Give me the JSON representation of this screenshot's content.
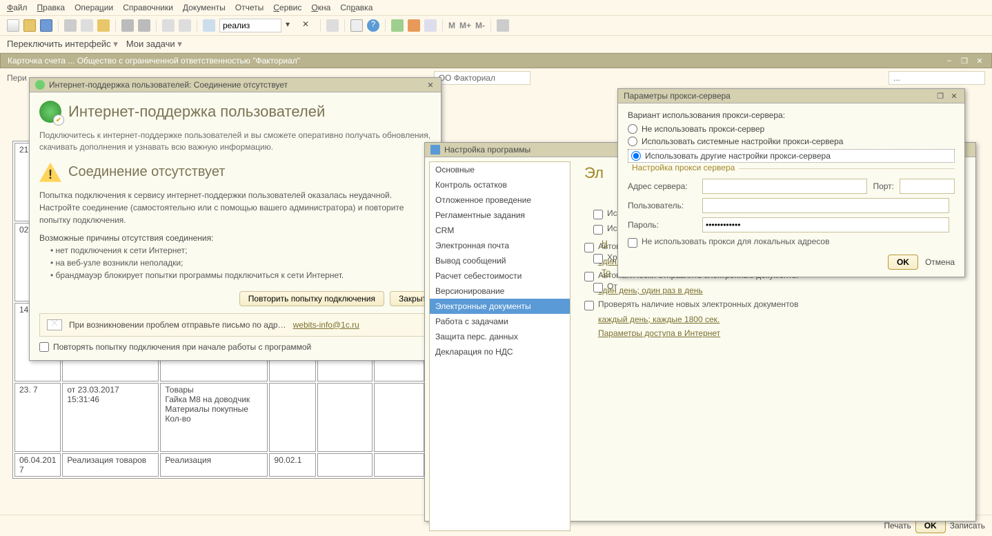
{
  "menubar": {
    "items": [
      "Файл",
      "Правка",
      "Операции",
      "Справочники",
      "Документы",
      "Отчеты",
      "Сервис",
      "Окна",
      "Справка"
    ]
  },
  "toolbar": {
    "search_value": "реализ",
    "m1": "M",
    "m2": "M+",
    "m3": "M-"
  },
  "switcher": {
    "a": "Переключить интерфейс",
    "b": "Мои задачи"
  },
  "doc_title": "Карточка счета ... Общество с ограниченной ответственностью \"Факториал\"",
  "bg": {
    "period_label": "Пери",
    "org_value": "ОО Факториал",
    "tbl": {
      "r1c1": "21.\n7",
      "r1c2": "",
      "r1c3": "",
      "r1c4": "",
      "r1c5": "",
      "r1c6": "",
      "r2c1": "02.\n7",
      "r2c2": "",
      "r2c3": "",
      "r2c4": "",
      "r2c5": "",
      "r2c6": "",
      "r3c1": "14.\n7",
      "r3c2": "",
      "r3c3": "",
      "r3c4": "",
      "r3c5": "",
      "r3c6": "",
      "r4c1": "23.\n7",
      "r4c2": "от 23.03.2017\n15:31:46",
      "r4c3": "Товары\nГайка М8 на доводчик\nМатериалы покупные\nКол-во",
      "r4c4": "",
      "r4c5": "",
      "r4c6": "",
      "r5c1": "06.04.201\n7",
      "r5c2": "Реализация товаров",
      "r5c3": "Реализация",
      "r5c4": "90.02.1",
      "r5c5": "",
      "r5c6": ""
    }
  },
  "bottom": {
    "a": "Печать",
    "b": "OK",
    "c": "Записать"
  },
  "isup": {
    "title": "Интернет-поддержка пользователей: Соединение отсутствует",
    "header": "Интернет-поддержка пользователей",
    "intro": "Подключитесь к интернет-поддержке пользователей и вы сможете оперативно получать обновления, скачивать дополнения и узнавать всю важную информацию.",
    "warn_title": "Соединение отсутствует",
    "text1": "Попытка подключения к сервису интернет-поддержки пользователей оказалась неудачной. Настройте соединение (самостоятельно или с помощью вашего администратора) и повторите попытку подключения.",
    "reasons_title": "Возможные причины отсутствия соединения:",
    "r1": "нет подключения к сети Интернет;",
    "r2": "на веб-узле возникли неполадки;",
    "r3": "брандмауэр блокирует попытки программы подключиться к сети Интернет.",
    "retry_btn": "Повторить попытку подключения",
    "close_btn": "Закрыть",
    "mail_text": "При возникновении проблем отправьте письмо по адр…",
    "mail_link": "webits-info@1c.ru",
    "chk_label": "Повторять попытку подключения при начале работы с программой"
  },
  "settings": {
    "title": "Настройка программы",
    "nav": [
      "Основные",
      "Контроль остатков",
      "Отложенное проведение",
      "Регламентные задания",
      "CRM",
      "Электронная почта",
      "Вывод сообщений",
      "Расчет себестоимости",
      "Версионирование",
      "Электронные документы",
      "Работа с задачами",
      "Защита перс. данных",
      "Декларация по НДС"
    ],
    "nav_selected": 9,
    "h1": "Эл",
    "chk1": "Ис",
    "chk2": "Ис",
    "link_na": "Н",
    "chk3": "Хр",
    "link_to": "То",
    "chk4": "От",
    "chk5": "Автоматически получать электронные документы",
    "link5": "один день; один раз в день",
    "chk6": "Автоматически отправлять электронные документы",
    "link6": "один день; один раз в день",
    "chk7": "Проверять наличие новых электронных документов",
    "link7": "каждый день; каждые 1800 сек.",
    "link8": "Параметры доступа в Интернет"
  },
  "proxy": {
    "title": "Параметры прокси-сервера",
    "group_title": "Вариант использования прокси-сервера:",
    "r1": "Не использовать прокси-сервер",
    "r2": "Использовать системные настройки прокси-сервера",
    "r3": "Использовать другие настройки прокси-сервера",
    "fs_label": "Настройка прокси сервера",
    "addr_label": "Адрес сервера:",
    "port_label": "Порт:",
    "user_label": "Пользователь:",
    "pass_label": "Пароль:",
    "pass_value": "............",
    "no_local": "Не использовать прокси для локальных адресов",
    "ok": "OK",
    "cancel": "Отмена"
  }
}
